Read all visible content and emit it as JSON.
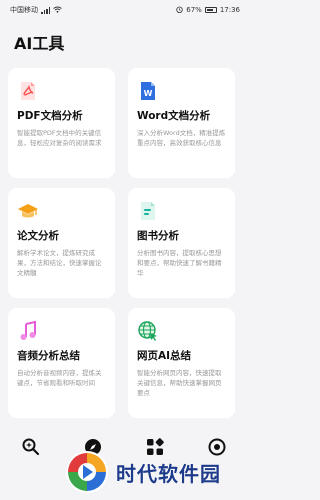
{
  "status_bar": {
    "carrier": "中国移动",
    "battery": "67%",
    "time": "17:36"
  },
  "page": {
    "title": "AI工具"
  },
  "cards": [
    {
      "title": "PDF文档分析",
      "desc": "智能提取PDF文档中的关键信息，轻松应对复杂的阅读需求",
      "icon": "pdf-icon",
      "color": "#ff4a4a"
    },
    {
      "title": "Word文档分析",
      "desc": "深入分析Word文档，精准提炼重点内容，高效获取核心信息",
      "icon": "word-icon",
      "color": "#2f6fe0"
    },
    {
      "title": "论文分析",
      "desc": "解析学术论文，提炼研究成果，方法和结论，快速掌握论文精髓",
      "icon": "graduation-cap-icon",
      "color": "#f4a118"
    },
    {
      "title": "图书分析",
      "desc": "分析图书内容，提取核心思想和要点，帮助快速了解书籍精华",
      "icon": "book-icon",
      "color": "#16b59a"
    },
    {
      "title": "音频分析总结",
      "desc": "自动分析音视频内容，提炼关键点，节省观看和听取时间",
      "icon": "music-note-icon",
      "color": "#e65bd8"
    },
    {
      "title": "网页AI总结",
      "desc": "智能分析网页内容，快速提取关键信息，帮助快速掌握网页要点",
      "icon": "globe-icon",
      "color": "#1aa55a"
    }
  ],
  "watermark": {
    "text": "时代软件园"
  }
}
